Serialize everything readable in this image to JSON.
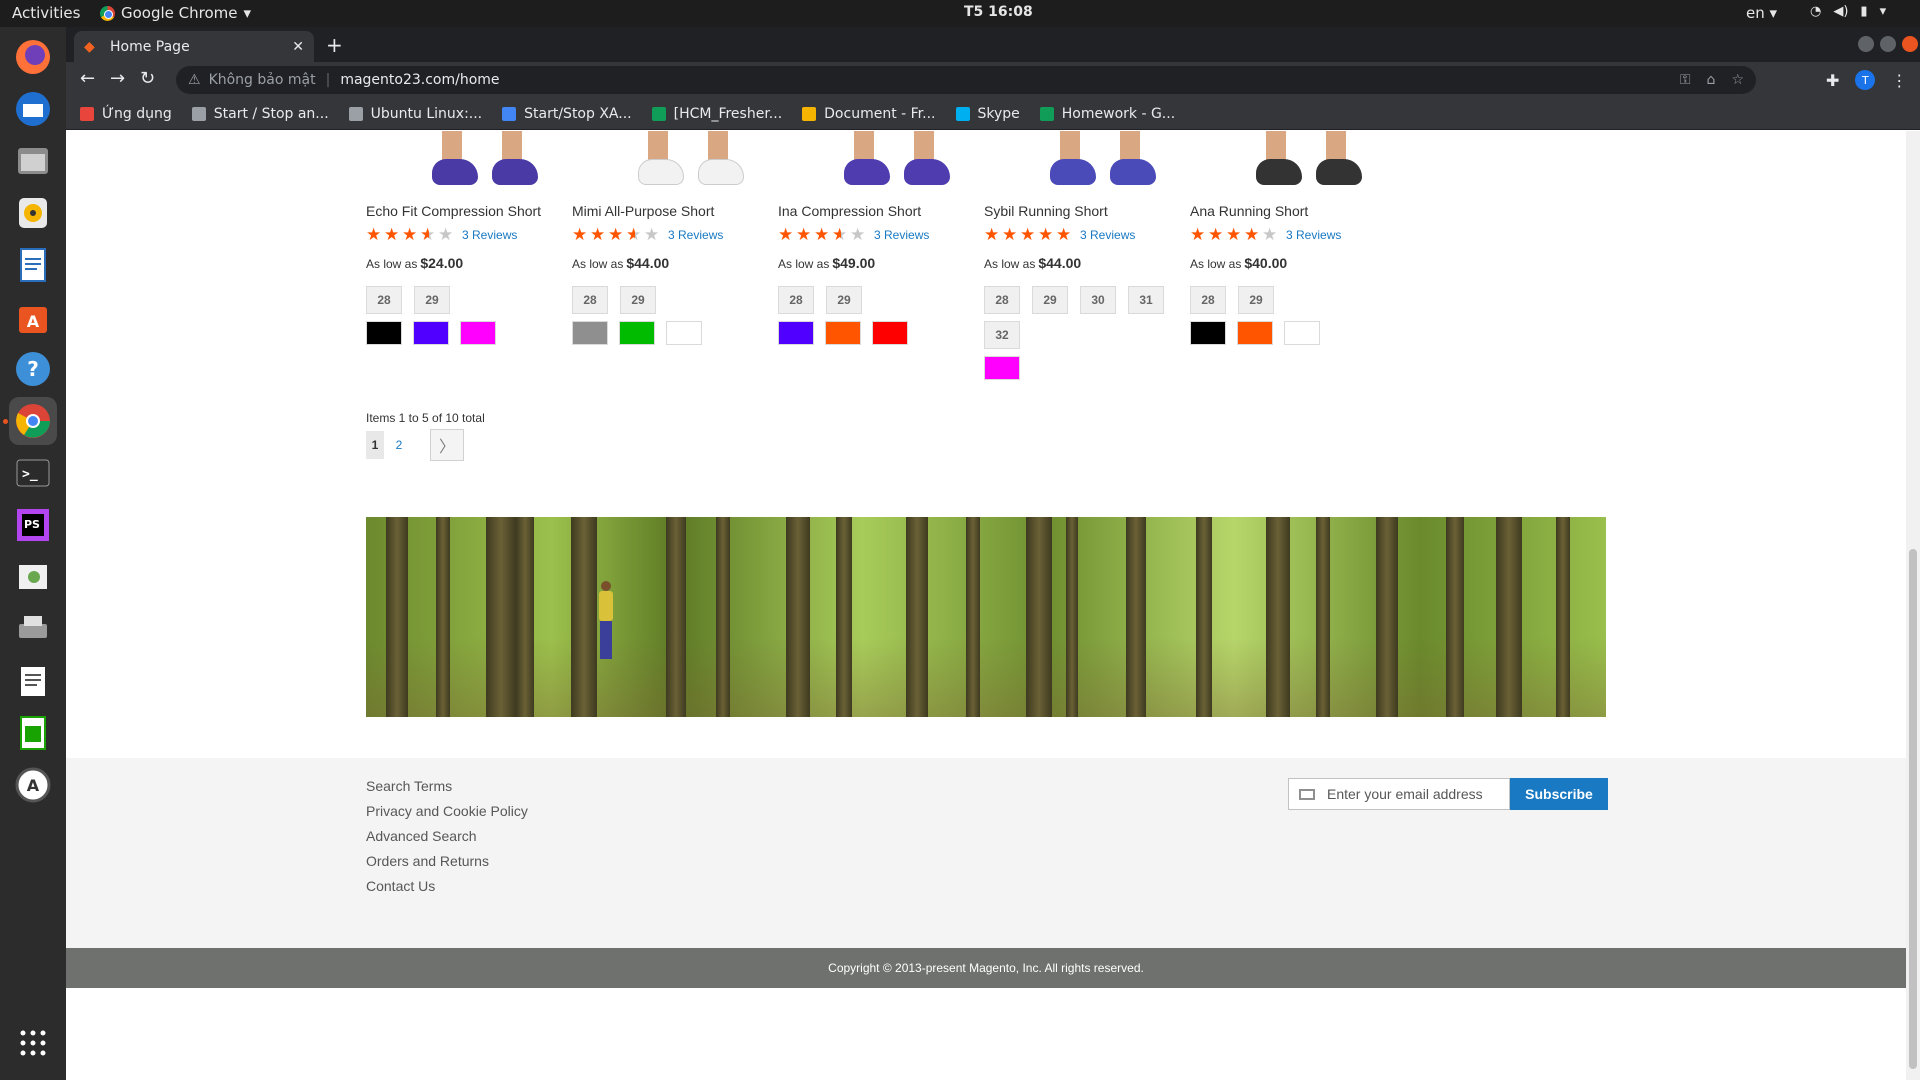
{
  "os": {
    "activities": "Activities",
    "app_name": "Google Chrome",
    "clock": "T5 16:08",
    "lang": "en"
  },
  "browser": {
    "tab_title": "Home Page",
    "insecure_label": "Không bảo mật",
    "url": "magento23.com/home",
    "avatar_letter": "T",
    "bookmarks": [
      {
        "label": "Ứng dụng",
        "color": "#e8453c"
      },
      {
        "label": "Start / Stop an...",
        "color": "#9aa0a6"
      },
      {
        "label": "Ubuntu Linux:...",
        "color": "#9aa0a6"
      },
      {
        "label": "Start/Stop XA...",
        "color": "#4285f4"
      },
      {
        "label": "[HCM_Fresher...",
        "color": "#0f9d58"
      },
      {
        "label": "Document - Fr...",
        "color": "#f4b400"
      },
      {
        "label": "Skype",
        "color": "#00aff0"
      },
      {
        "label": "Homework - G...",
        "color": "#0f9d58"
      }
    ]
  },
  "products": [
    {
      "name": "Echo Fit Compression Short",
      "rating": 3.5,
      "reviews": "3 Reviews",
      "price_prefix": "As low as",
      "price": "$24.00",
      "sizes": [
        "28",
        "29"
      ],
      "swatches": [
        "#000000",
        "#5000ff",
        "#ff00ff"
      ],
      "shoe": "#4a3aa5"
    },
    {
      "name": "Mimi All-Purpose Short",
      "rating": 3.5,
      "reviews": "3 Reviews",
      "price_prefix": "As low as",
      "price": "$44.00",
      "sizes": [
        "28",
        "29"
      ],
      "swatches": [
        "#8f8f8f",
        "#00bb00",
        "#ffffff"
      ],
      "shoe": "#f2f2f2"
    },
    {
      "name": "Ina Compression Short",
      "rating": 3.5,
      "reviews": "3 Reviews",
      "price_prefix": "As low as",
      "price": "$49.00",
      "sizes": [
        "28",
        "29"
      ],
      "swatches": [
        "#5000ff",
        "#ff5500",
        "#ff0000"
      ],
      "shoe": "#4f3db0"
    },
    {
      "name": "Sybil Running Short",
      "rating": 5,
      "reviews": "3 Reviews",
      "price_prefix": "As low as",
      "price": "$44.00",
      "sizes": [
        "28",
        "29",
        "30",
        "31",
        "32"
      ],
      "swatches": [
        "#ff00ff"
      ],
      "shoe": "#4a4ab8"
    },
    {
      "name": "Ana Running Short",
      "rating": 4,
      "reviews": "3 Reviews",
      "price_prefix": "As low as",
      "price": "$40.00",
      "sizes": [
        "28",
        "29"
      ],
      "swatches": [
        "#000000",
        "#ff5500",
        "#ffffff"
      ],
      "shoe": "#333333"
    }
  ],
  "pager": {
    "info": "Items 1 to 5 of 10 total",
    "current": "1",
    "next_page": "2"
  },
  "footer": {
    "links": [
      "Search Terms",
      "Privacy and Cookie Policy",
      "Advanced Search",
      "Orders and Returns",
      "Contact Us"
    ],
    "email_placeholder": "Enter your email address",
    "subscribe_label": "Subscribe",
    "copyright": "Copyright © 2013-present Magento, Inc. All rights reserved."
  }
}
